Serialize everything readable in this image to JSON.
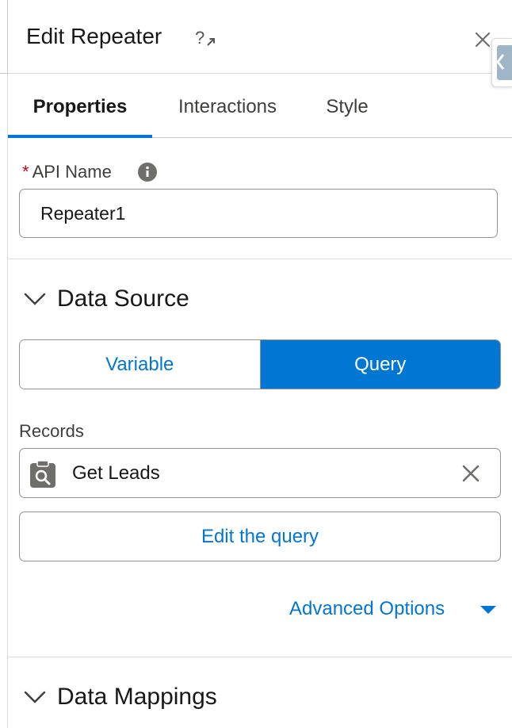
{
  "header": {
    "title": "Edit Repeater",
    "help_icon": "help-external-link-icon",
    "close_icon": "close-icon"
  },
  "tabs": [
    {
      "label": "Properties",
      "active": true
    },
    {
      "label": "Interactions",
      "active": false
    },
    {
      "label": "Style",
      "active": false
    }
  ],
  "api_name": {
    "required_marker": "*",
    "label": "API Name",
    "value": "Repeater1"
  },
  "data_source": {
    "section_title": "Data Source",
    "options": [
      {
        "label": "Variable",
        "selected": false
      },
      {
        "label": "Query",
        "selected": true
      }
    ],
    "records_label": "Records",
    "records_value": "Get Leads",
    "edit_query_label": "Edit the query",
    "advanced_options_label": "Advanced Options"
  },
  "data_mappings": {
    "section_title": "Data Mappings"
  },
  "colors": {
    "brand": "#0176d3",
    "required": "#ba0517",
    "border": "#939393",
    "divider": "#dddbda"
  }
}
